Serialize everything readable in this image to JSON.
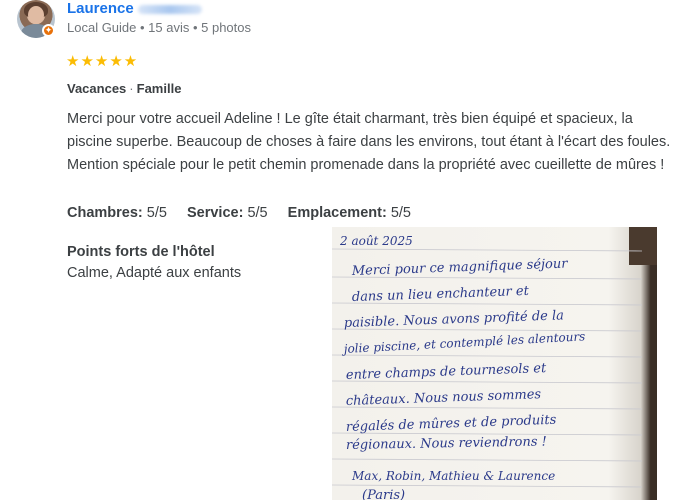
{
  "reviewer": {
    "name": "Laurence",
    "meta": "Local Guide • 15 avis • 5 photos"
  },
  "rating": {
    "stars": 5,
    "stars_display": "★★★★★"
  },
  "tags": {
    "trip_type": "Vacances",
    "companion": "Famille",
    "separator": "·"
  },
  "review": {
    "text": "Merci pour votre accueil Adeline ! Le gîte était charmant, très bien équipé et spacieux, la piscine superbe. Beaucoup de choses à faire dans les environs, tout étant à l'écart des foules. Mention spéciale pour le petit chemin promenade dans la propriété avec cueillette de mûres !"
  },
  "sub_ratings": [
    {
      "label": "Chambres:",
      "value": "5/5"
    },
    {
      "label": "Service:",
      "value": "5/5"
    },
    {
      "label": "Emplacement:",
      "value": "5/5"
    }
  ],
  "highlights": {
    "title": "Points forts de l'hôtel",
    "value": "Calme, Adapté aux enfants"
  },
  "photo": {
    "lines": [
      "2 août 2025",
      "Merci pour ce magnifique séjour",
      "dans un lieu enchanteur et",
      "paisible. Nous avons profité de la",
      "jolie piscine, et contemplé les alentours",
      "entre champs de tournesols et",
      "châteaux. Nous nous sommes",
      "régalés de mûres et de produits",
      "régionaux. Nous reviendrons !",
      "Max, Robin, Mathieu & Laurence",
      "(Paris)"
    ]
  },
  "colors": {
    "accent": "#1a73e8",
    "star": "#fbbc04",
    "badge": "#e8710a"
  }
}
